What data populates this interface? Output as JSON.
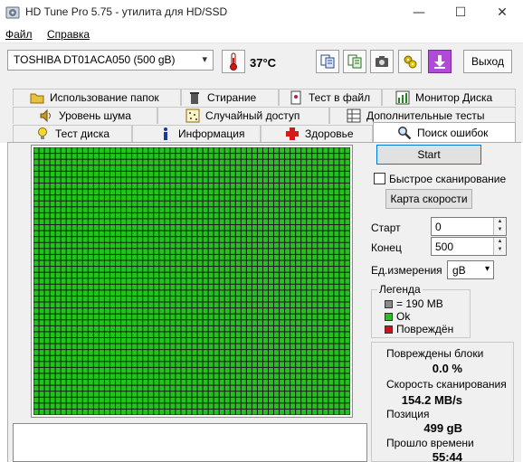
{
  "window": {
    "title": "HD Tune Pro 5.75 - утилита для HD/SSD",
    "minimize": "—",
    "maximize": "☐",
    "close": "✕"
  },
  "menu": {
    "file": "Файл",
    "help": "Справка"
  },
  "toolbar": {
    "drive": "TOSHIBA DT01ACA050 (500 gB)",
    "temperature": "37°C",
    "exit_label": "Выход",
    "icons": [
      "copy-icon",
      "copy-info-icon",
      "camera-icon",
      "settings-icon",
      "download-icon"
    ]
  },
  "tabs": {
    "row1": [
      "Использование папок",
      "Стирание",
      "Тест в файл",
      "Монитор Диска"
    ],
    "row2": [
      "Уровень шума",
      "Случайный доступ",
      "Дополнительные  тесты"
    ],
    "row3": [
      "Тест диска",
      "Информация",
      "Здоровье",
      "Поиск ошибок"
    ],
    "active": "Поиск ошибок"
  },
  "scan": {
    "start_label": "Start",
    "quick_scan_label": "Быстрое сканирование",
    "quick_scan_checked": false,
    "speed_map_label": "Карта скорости",
    "start_field_label": "Старт",
    "start_value": "0",
    "end_field_label": "Конец",
    "end_value": "500",
    "unit_label": "Ед.измерения",
    "unit_value": "gB"
  },
  "legend": {
    "title": "Легенда",
    "block_size": "= 190 MB",
    "ok": "Ok",
    "damaged": "Повреждён"
  },
  "stats": {
    "damaged_label": "Повреждены блоки",
    "damaged_value": "0.0 %",
    "speed_label": "Скорость сканирования",
    "speed_value": "154.2 MB/s",
    "position_label": "Позиция",
    "position_value": "499 gB",
    "elapsed_label": "Прошло времени",
    "elapsed_value": "55:44"
  },
  "colors": {
    "ok_block": "#22c31c",
    "damaged_block": "#c8141e",
    "unscanned_block": "#8a8a8a",
    "grid_line": "#1a1a1a"
  },
  "block_grid": {
    "total_blocks": 2610,
    "status": "ok"
  }
}
